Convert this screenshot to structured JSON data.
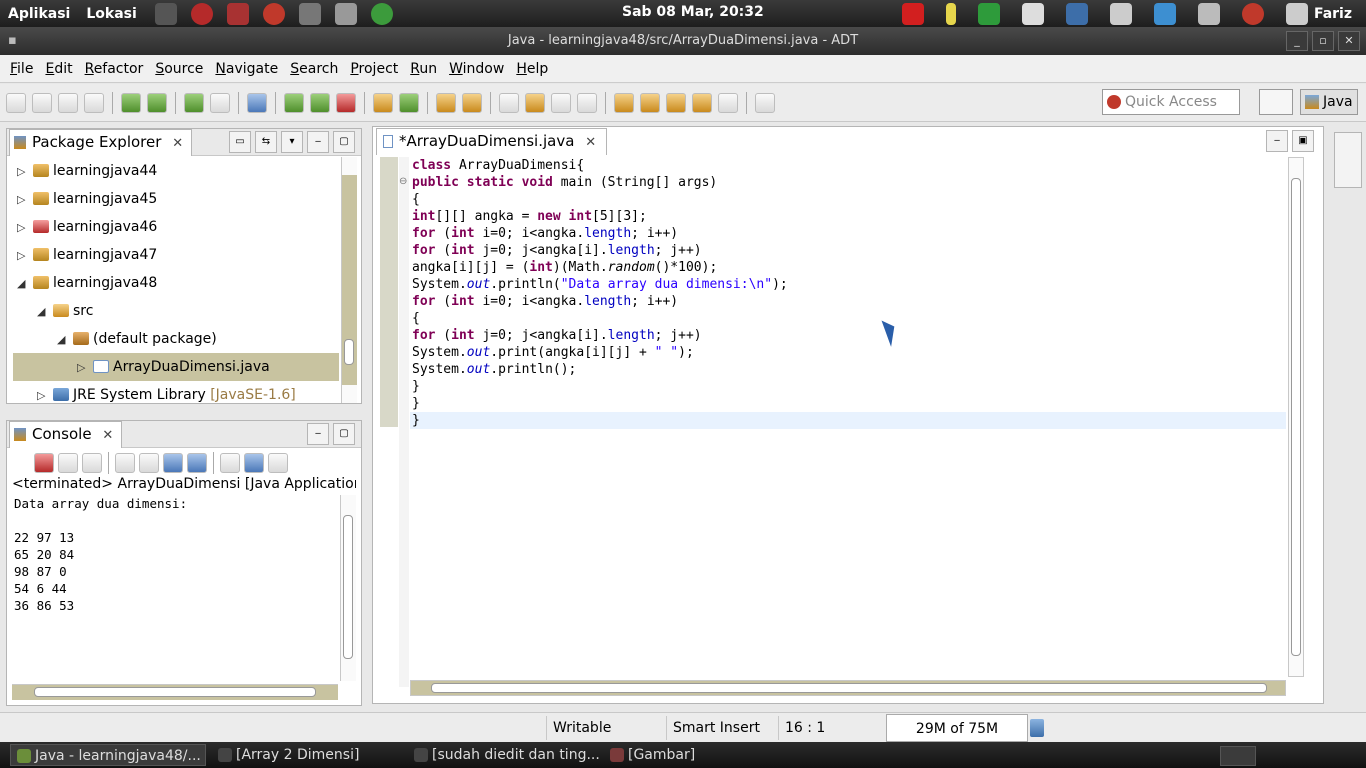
{
  "top_panel": {
    "menus": [
      "Aplikasi",
      "Lokasi"
    ],
    "clock": "Sab 08 Mar, 20:32",
    "user": "Fariz"
  },
  "window": {
    "title": "Java - learningjava48/src/ArrayDuaDimensi.java - ADT"
  },
  "menu_bar": [
    "File",
    "Edit",
    "Refactor",
    "Source",
    "Navigate",
    "Search",
    "Project",
    "Run",
    "Window",
    "Help"
  ],
  "toolbar": {
    "quick_access_placeholder": "Quick Access",
    "perspective": "Java"
  },
  "package_explorer": {
    "title": "Package Explorer",
    "items": [
      {
        "label": "learningjava44",
        "arrow": "▷",
        "icon": "project-icon"
      },
      {
        "label": "learningjava45",
        "arrow": "▷",
        "icon": "project-icon"
      },
      {
        "label": "learningjava46",
        "arrow": "▷",
        "icon": "project-error-icon"
      },
      {
        "label": "learningjava47",
        "arrow": "▷",
        "icon": "project-icon"
      },
      {
        "label": "learningjava48",
        "arrow": "◢",
        "icon": "project-icon"
      },
      {
        "label": "src",
        "arrow": "◢",
        "icon": "source-folder-icon"
      },
      {
        "label": "(default package)",
        "arrow": "◢",
        "icon": "package-icon"
      },
      {
        "label": "ArrayDuaDimensi.java",
        "arrow": "▷",
        "icon": "java-file-icon"
      },
      {
        "label": "JRE System Library",
        "suffix": "[JavaSE-1.6]",
        "arrow": "▷",
        "icon": "jre-library-icon"
      }
    ]
  },
  "console": {
    "title": "Console",
    "status": "<terminated> ArrayDuaDimensi [Java Application] /usr",
    "output": [
      "Data array dua dimensi:",
      "",
      "22 97 13",
      "65 20 84",
      "98 87 0",
      "54 6 44",
      "36 86 53"
    ]
  },
  "editor": {
    "tab_label": "*ArrayDuaDimensi.java",
    "code": [
      "class ArrayDuaDimensi{",
      "public static void main (String[] args)",
      "{",
      "int[][] angka = new int[5][3];",
      "for (int i=0; i<angka.length; i++)",
      "for (int j=0; j<angka[i].length; j++)",
      "angka[i][j] = (int)(Math.random()*100);",
      "System.out.println(\"Data array dua dimensi:\\n\");",
      "for (int i=0; i<angka.length; i++)",
      "{",
      "for (int j=0; j<angka[i].length; j++)",
      "System.out.print(angka[i][j] + \" \");",
      "System.out.println();",
      "}",
      "}",
      "}"
    ]
  },
  "status_bar": {
    "writable": "Writable",
    "insert_mode": "Smart Insert",
    "position": "16 : 1",
    "heap": "29M of 75M"
  },
  "taskbar": [
    {
      "label": "Java - learningjava48/...",
      "active": true
    },
    {
      "label": "[Array 2 Dimensi]",
      "active": false
    },
    {
      "label": "[sudah diedit dan ting...",
      "active": false
    },
    {
      "label": "[Gambar]",
      "active": false
    }
  ]
}
